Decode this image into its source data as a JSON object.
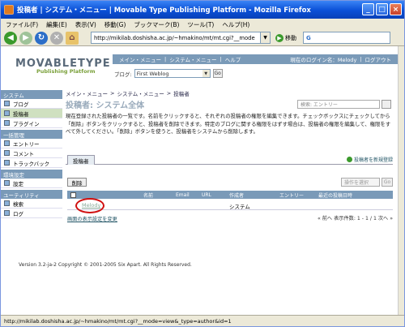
{
  "window": {
    "title": "投稿者 | システム・メニュー | Movable Type Publishing Platform - Mozilla Firefox"
  },
  "menubar": [
    "ファイル(F)",
    "編集(E)",
    "表示(V)",
    "移動(G)",
    "ブックマーク(B)",
    "ツール(T)",
    "ヘルプ(H)"
  ],
  "toolbar": {
    "url": "http://mikilab.doshisha.ac.jp/~hmakino/mt/mt.cgi?__mode",
    "go_label": "移動",
    "search_engine": "G"
  },
  "header": {
    "logo_main": "MOVABLETYPE",
    "logo_sub": "Publishing Platform",
    "nav": [
      "メイン・メニュー",
      "システム・メニュー",
      "ヘルプ"
    ],
    "user_status": "現在のログイン名：Melody",
    "logout": "ログアウト",
    "blog_label": "ブログ:",
    "blog_select": "First Weblog",
    "blog_go": "Go"
  },
  "sidebar": {
    "sections": [
      {
        "title": "システム",
        "items": [
          "ブログ",
          "投稿者",
          "プラグイン"
        ]
      },
      {
        "title": "一括管理",
        "items": [
          "エントリー",
          "コメント",
          "トラックバック"
        ]
      },
      {
        "title": "環境設定",
        "items": [
          "設定"
        ]
      },
      {
        "title": "ユーティリティ",
        "items": [
          "検索",
          "ログ"
        ]
      }
    ]
  },
  "main": {
    "breadcrumb": [
      "メイン・メニュー",
      "システム・メニュー",
      "投稿者"
    ],
    "title": "投稿者: システム全体",
    "search_placeholder": "検索: エントリー",
    "description": "現在登録された投稿者の一覧です。名前をクリックすると、それぞれの投稿者の権限を編集できます。チェックボックスにチェックしてから「削除」ボタンをクリックすると、投稿者を削除できます。特定のブログに関する権限をはずす場合は、投稿者の権限を編集して、権限をすべて外してください。「削除」ボタンを使うと、投稿者をシステムから削除します。",
    "tab": "投稿者",
    "new_link": "投稿者を新規登録",
    "delete_button": "削除",
    "action_select": "操作を選択",
    "action_go": "Go",
    "columns": [
      "名前",
      "Email",
      "URL",
      "作成者",
      "エントリー",
      "最近の投稿日時"
    ],
    "rows": [
      {
        "name": "Melody",
        "email": "",
        "url": "",
        "creator": "システム",
        "entries": "",
        "last_post": ""
      }
    ],
    "display_settings": "画面の表示設定を変更",
    "pager_prev": "« 前へ",
    "pager_info": "表示件数: 1 - 1 / 1",
    "pager_next": "次へ »"
  },
  "version": "Version 3.2-ja-2 Copyright © 2001-2005 Six Apart. All Rights Reserved.",
  "status_bar": "http://mikilab.doshisha.ac.jp/~hmakino/mt/mt.cgi?__mode=view&_type=author&id=1"
}
